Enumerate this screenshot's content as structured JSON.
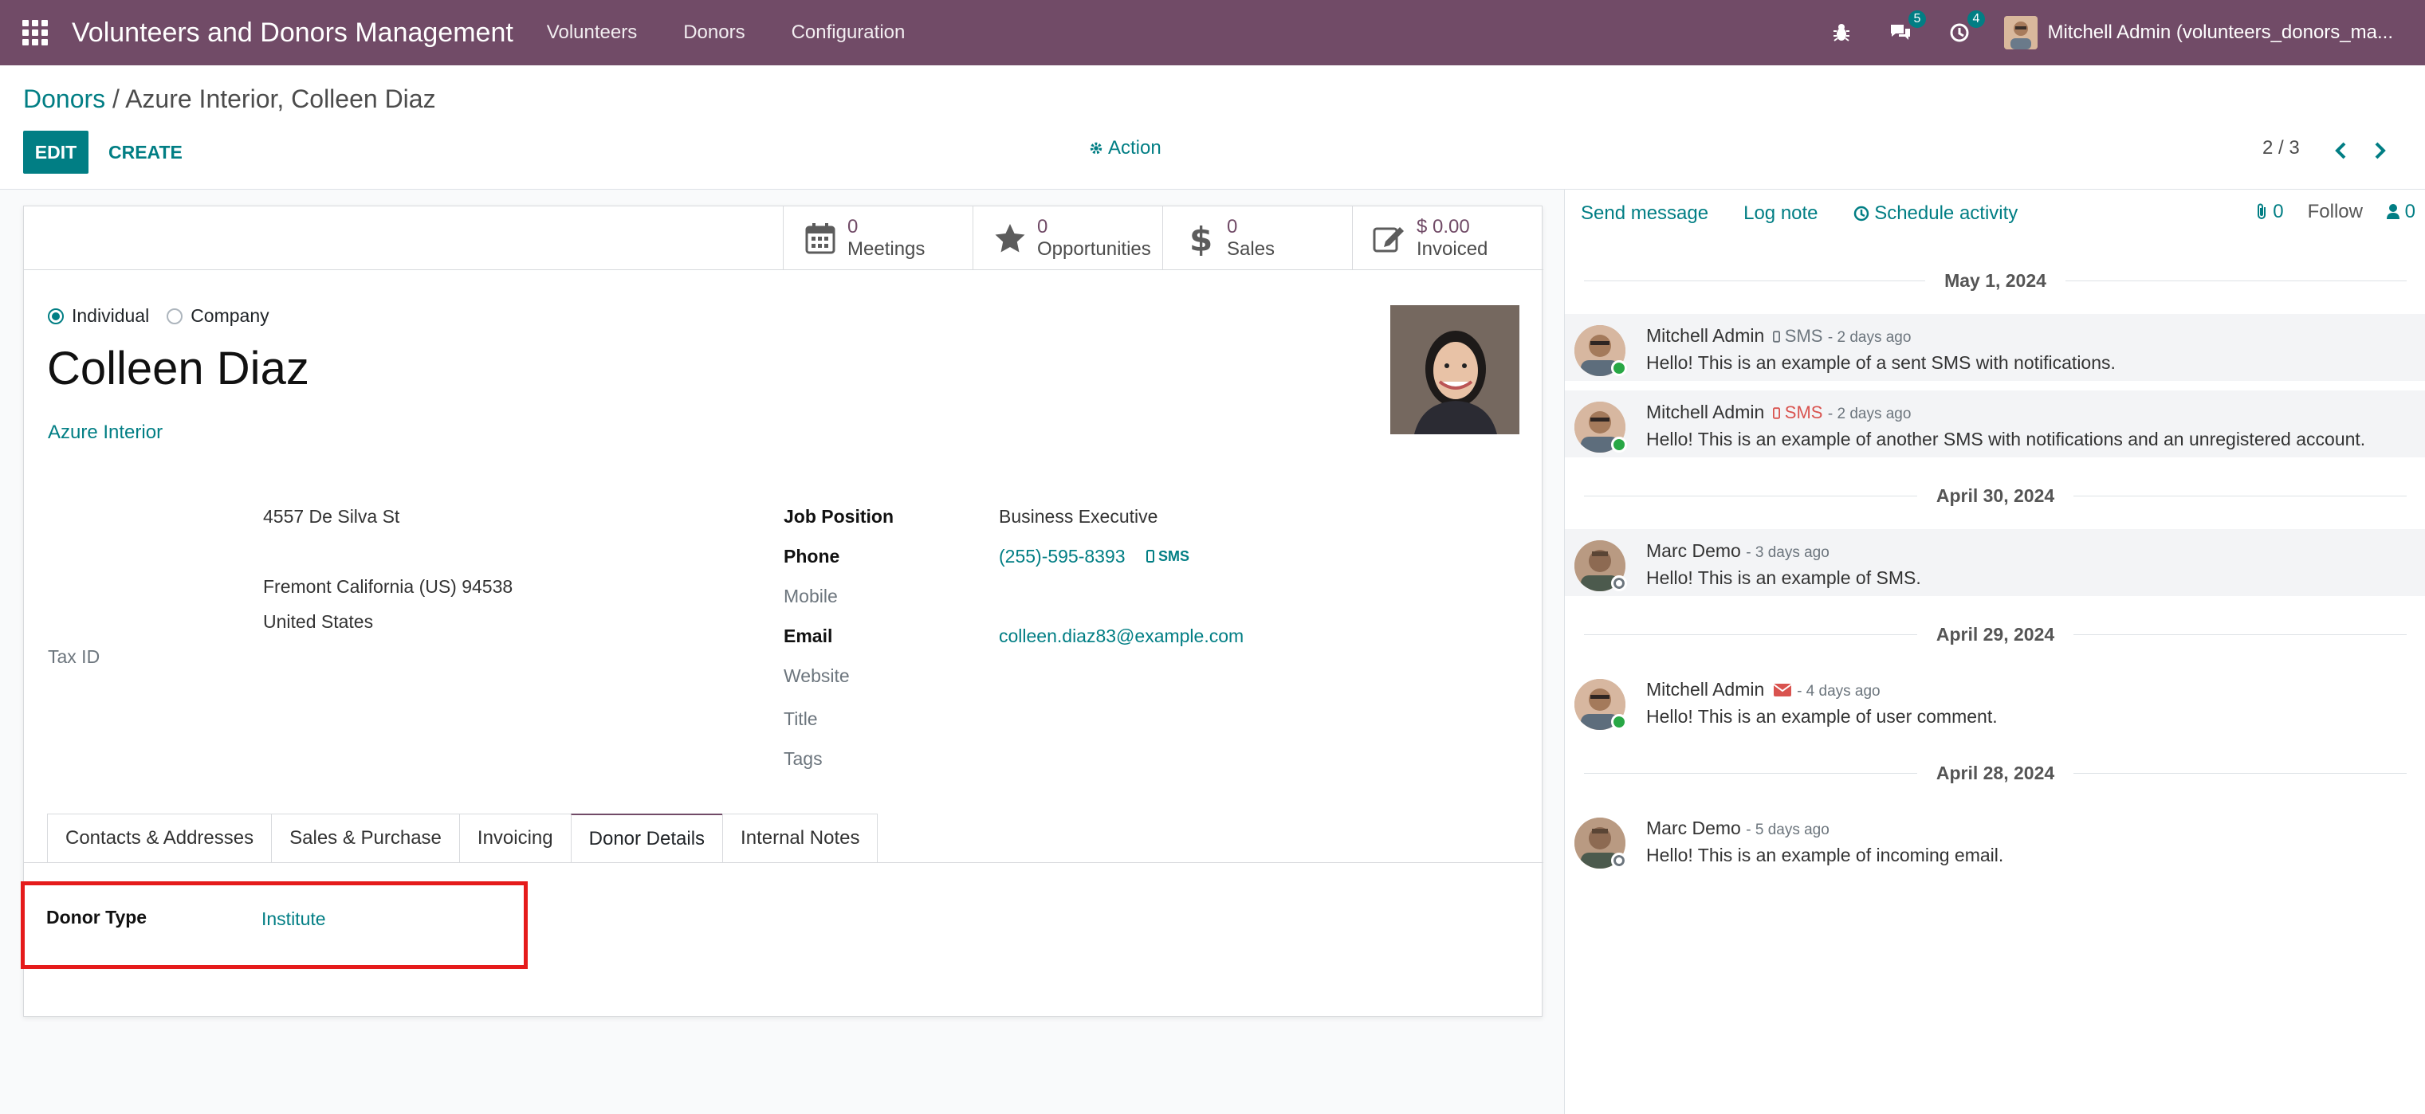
{
  "navbar": {
    "app_title": "Volunteers and Donors Management",
    "menu": [
      "Volunteers",
      "Donors",
      "Configuration"
    ],
    "messages_count": "5",
    "activities_count": "4",
    "user": "Mitchell Admin (volunteers_donors_ma..."
  },
  "breadcrumb": {
    "parent": "Donors",
    "current": "/ Azure Interior, Colleen Diaz"
  },
  "toolbar": {
    "edit": "EDIT",
    "create": "CREATE",
    "action": "Action",
    "pager": "2 / 3"
  },
  "stats": [
    {
      "value": "0",
      "label": "Meetings",
      "icon": "calendar-icon"
    },
    {
      "value": "0",
      "label": "Opportunities",
      "icon": "star-icon"
    },
    {
      "value": "0",
      "label": "Sales",
      "icon": "dollar-icon"
    },
    {
      "value": "$ 0.00",
      "label": "Invoiced",
      "icon": "edit-icon"
    }
  ],
  "partner": {
    "type_individual": "Individual",
    "type_company": "Company",
    "selected_type": "Individual",
    "name": "Colleen Diaz",
    "company": "Azure Interior",
    "street": "4557 De Silva St",
    "city_line": "Fremont  California (US)  94538",
    "country": "United States",
    "tax_id_label": "Tax ID"
  },
  "fields": {
    "job_position_label": "Job Position",
    "job_position": "Business Executive",
    "phone_label": "Phone",
    "phone": "(255)-595-8393",
    "sms": "SMS",
    "mobile_label": "Mobile",
    "email_label": "Email",
    "email": "colleen.diaz83@example.com",
    "website_label": "Website",
    "title_label": "Title",
    "tags_label": "Tags"
  },
  "tabs": [
    "Contacts & Addresses",
    "Sales & Purchase",
    "Invoicing",
    "Donor Details",
    "Internal Notes"
  ],
  "active_tab": "Donor Details",
  "donor": {
    "label": "Donor Type",
    "value": "Institute"
  },
  "chatter": {
    "send_message": "Send message",
    "log_note": "Log note",
    "schedule_activity": "Schedule activity",
    "attachments": "0",
    "follow": "Follow",
    "followers": "0",
    "dates": [
      "May 1, 2024",
      "April 30, 2024",
      "April 29, 2024",
      "April 28, 2024"
    ],
    "messages": [
      {
        "author": "Mitchell Admin",
        "kind": "SMS",
        "time": "- 2 days ago",
        "body": "Hello! This is an example of a sent SMS with notifications."
      },
      {
        "author": "Mitchell Admin",
        "kind": "SMS",
        "time": "- 2 days ago",
        "body": "Hello! This is an example of another SMS with notifications and an unregistered account."
      },
      {
        "author": "Marc Demo",
        "kind": "",
        "time": "- 3 days ago",
        "body": "Hello! This is an example of SMS."
      },
      {
        "author": "Mitchell Admin",
        "kind": "",
        "time": "- 4 days ago",
        "body": "Hello! This is an example of user comment."
      },
      {
        "author": "Marc Demo",
        "kind": "",
        "time": "- 5 days ago",
        "body": "Hello! This is an example of incoming email."
      }
    ]
  },
  "colors": {
    "brand": "#714b67",
    "accent": "#017e84",
    "highlight": "#e51b1b"
  }
}
